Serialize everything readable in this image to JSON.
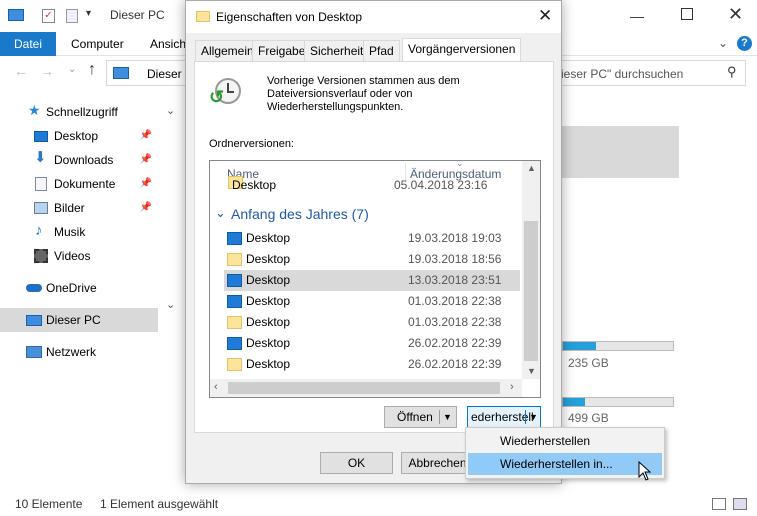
{
  "explorer": {
    "title": "Dieser PC",
    "ribbon_tabs": [
      "Datei",
      "Computer",
      "Ansich"
    ],
    "address_text": "Dieser",
    "search_placeholder": "ieser PC\" durchsuchen",
    "sidebar": {
      "items": [
        {
          "label": "Schnellzugriff",
          "icon": "star-icon"
        },
        {
          "label": "Desktop",
          "icon": "desktop-icon"
        },
        {
          "label": "Downloads",
          "icon": "download-icon"
        },
        {
          "label": "Dokumente",
          "icon": "document-icon"
        },
        {
          "label": "Bilder",
          "icon": "pictures-icon"
        },
        {
          "label": "Musik",
          "icon": "music-icon"
        },
        {
          "label": "Videos",
          "icon": "video-icon"
        },
        {
          "label": "OneDrive",
          "icon": "cloud-icon"
        },
        {
          "label": "Dieser PC",
          "icon": "computer-icon"
        },
        {
          "label": "Netzwerk",
          "icon": "network-icon"
        }
      ]
    },
    "drives": [
      {
        "free": "235 GB",
        "fill": 0.3
      },
      {
        "free": "499 GB",
        "fill": 0.2
      }
    ],
    "status": {
      "count": "10 Elemente",
      "selected": "1 Element ausgewählt"
    }
  },
  "dialog": {
    "title": "Eigenschaften von Desktop",
    "tabs": [
      "Allgemein",
      "Freigabe",
      "Sicherheit",
      "Pfad",
      "Vorgängerversionen"
    ],
    "info_text": [
      "Vorherige Versionen stammen aus dem",
      "Dateiversionsverlauf oder von",
      "Wiederherstellungspunkten."
    ],
    "list_label": "Ordnerversionen:",
    "columns": [
      "Name",
      "Änderungsdatum"
    ],
    "partial_row": {
      "name": "Desktop",
      "date": "05.04.2018 23:16"
    },
    "group_label": "Anfang des Jahres (7)",
    "rows": [
      {
        "name": "Desktop",
        "date": "19.03.2018 19:03",
        "icon": "desktop-icon"
      },
      {
        "name": "Desktop",
        "date": "19.03.2018 18:56",
        "icon": "folder-icon"
      },
      {
        "name": "Desktop",
        "date": "13.03.2018 23:51",
        "icon": "desktop-icon",
        "selected": true
      },
      {
        "name": "Desktop",
        "date": "01.03.2018 22:38",
        "icon": "desktop-icon"
      },
      {
        "name": "Desktop",
        "date": "01.03.2018 22:38",
        "icon": "folder-icon"
      },
      {
        "name": "Desktop",
        "date": "26.02.2018 22:39",
        "icon": "desktop-icon"
      },
      {
        "name": "Desktop",
        "date": "26.02.2018 22:39",
        "icon": "folder-icon"
      }
    ],
    "open_button": "Öffnen",
    "restore_button": "ederherstell",
    "ok_button": "OK",
    "cancel_button": "Abbrechen"
  },
  "context_menu": {
    "items": [
      "Wiederherstellen",
      "Wiederherstellen in..."
    ]
  },
  "colors": {
    "accent": "#1979ca",
    "selection": "#d9d9d9",
    "menu_hover": "#91c9f7"
  }
}
